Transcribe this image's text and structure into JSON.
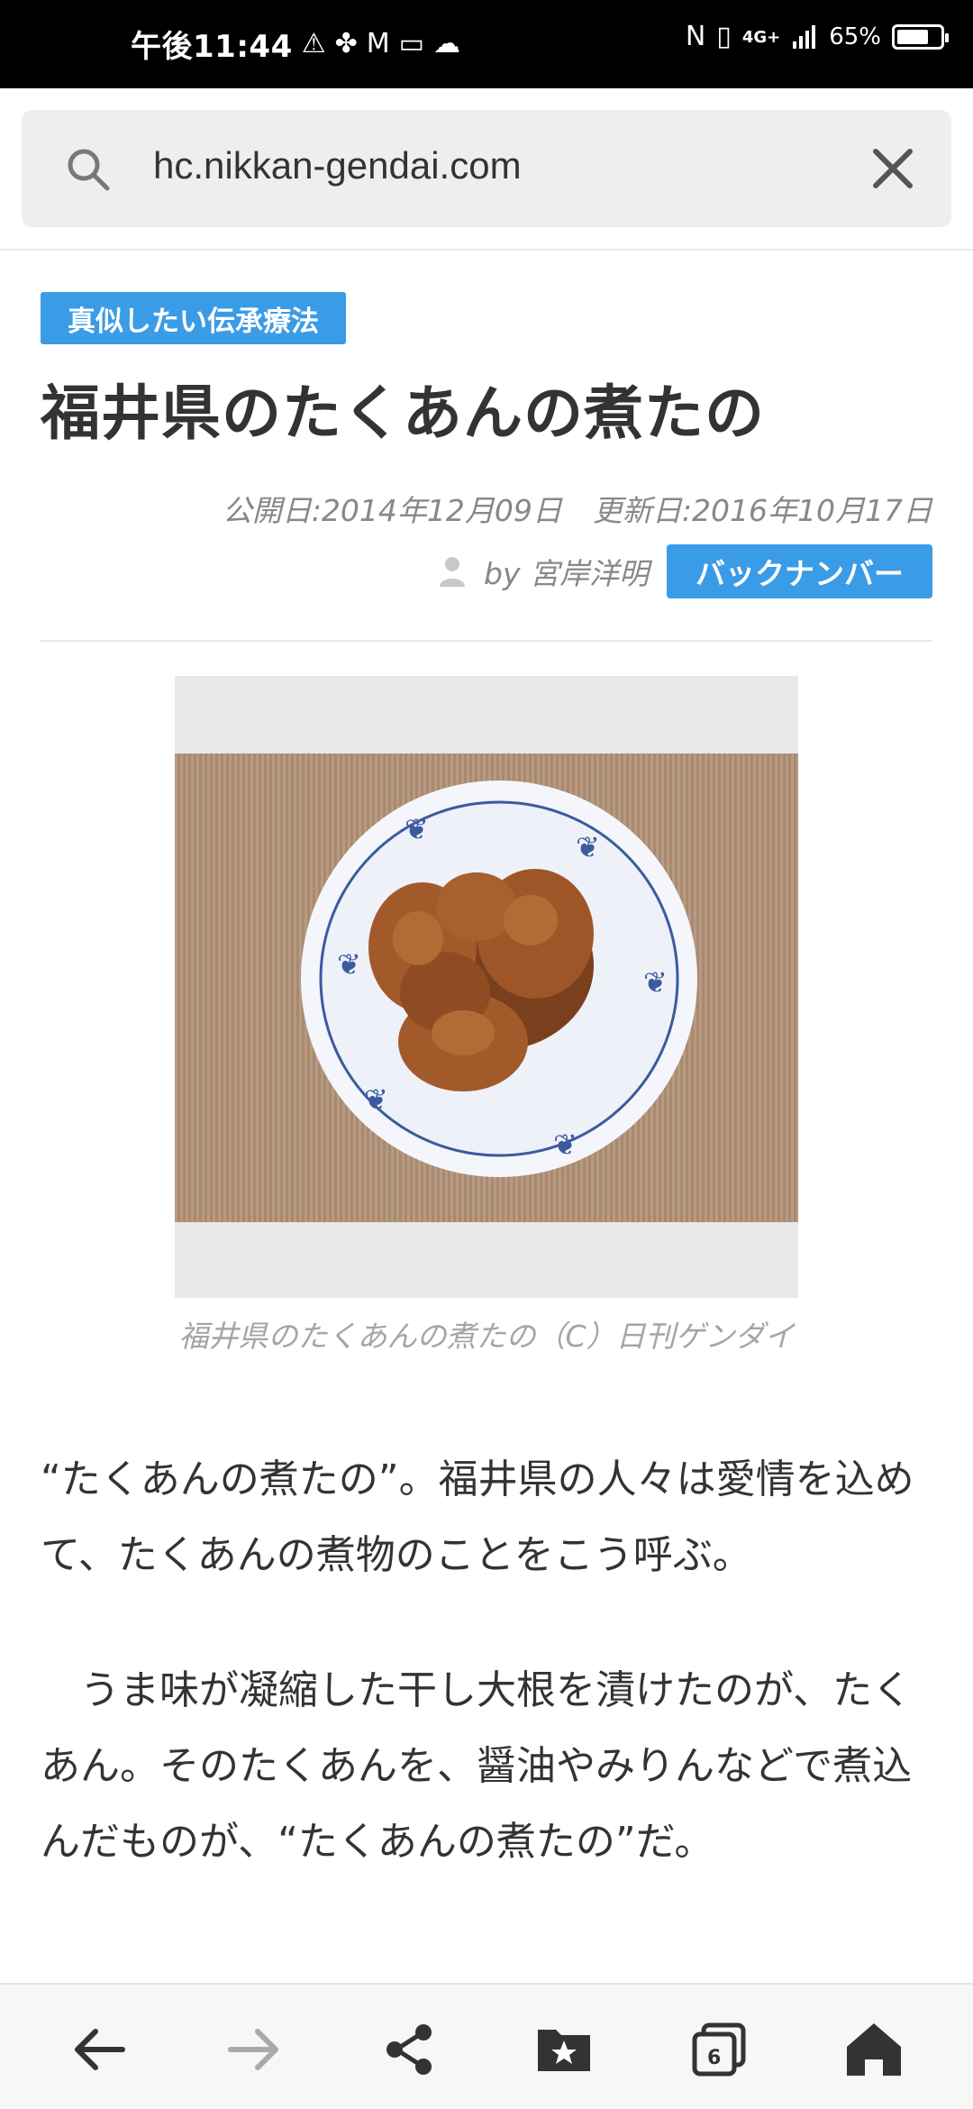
{
  "status_bar": {
    "time": "午後11:44",
    "network": "4G+",
    "battery_percent": "65%",
    "battery_level": 0.65
  },
  "address_bar": {
    "url": "hc.nikkan-gendai.com"
  },
  "article": {
    "category": "真似したい伝承療法",
    "title": "福井県のたくあんの煮たの",
    "published": "公開日:2014年12月09日",
    "updated": "更新日:2016年10月17日",
    "author": "by 宮岸洋明",
    "backnumber_label": "バックナンバー",
    "image_caption": "福井県のたくあんの煮たの（C）日刊ゲンダイ",
    "paragraphs": [
      "“たくあんの煮たの”。福井県の人々は愛情を込めて、たくあんの煮物のことをこう呼ぶ。",
      "　うま味が凝縮した干し大根を漬けたのが、たくあん。そのたくあんを、醤油やみりんなどで煮込んだものが、“たくあんの煮たの”だ。"
    ]
  },
  "bottom_nav": {
    "tab_count": "6",
    "items": [
      "back-icon",
      "forward-icon",
      "share-icon",
      "bookmarks-icon",
      "tabs-icon",
      "home-icon"
    ]
  },
  "colors": {
    "accent": "#3a9be6",
    "status_bar": "#000000",
    "address_bg": "#eeeeee"
  }
}
